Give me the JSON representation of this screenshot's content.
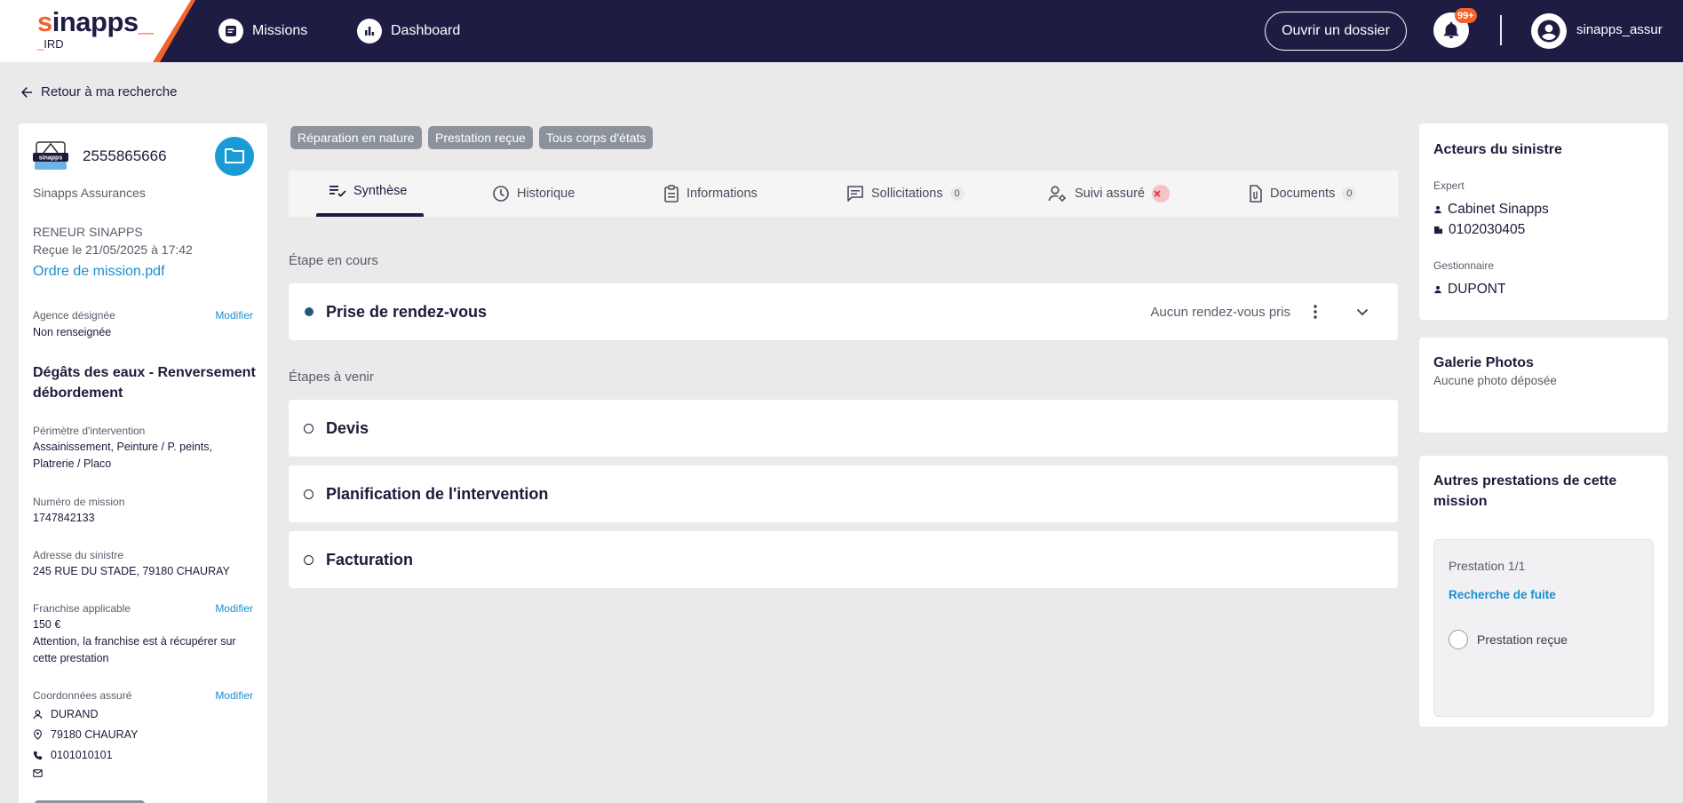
{
  "header": {
    "logo_main": "inapps",
    "logo_s": "s",
    "logo_sub": "IRD",
    "nav": [
      {
        "label": "Missions"
      },
      {
        "label": "Dashboard"
      }
    ],
    "open_button": "Ouvrir un dossier",
    "notif_badge": "99+",
    "username": "sinapps_assur"
  },
  "back_link": "Retour à ma recherche",
  "dossier": {
    "number": "2555865666",
    "insurer": "Sinapps Assurances",
    "logo_text": "sinapps",
    "renewer": "RENEUR SINAPPS",
    "received": "Reçue le 21/05/2025 à 17:42",
    "order_link": "Ordre de mission.pdf",
    "agency_label": "Agence désignée",
    "agency_value": "Non renseignée",
    "modify": "Modifier",
    "sinistre_title_1": "Dégâts des eaux - Renversement",
    "sinistre_title_2": "débordement",
    "perimeter_label": "Périmètre d'intervention",
    "perimeter_value_1": "Assainissement, Peinture / P. peints,",
    "perimeter_value_2": "Platrerie / Placo",
    "mission_label": "Numéro de mission",
    "mission_value": "1747842133",
    "address_label": "Adresse du sinistre",
    "address_value": "245 RUE DU STADE, 79180 CHAURAY",
    "franchise_label": "Franchise applicable",
    "franchise_value": "150 €",
    "franchise_note_1": "Attention, la franchise est à récupérer sur",
    "franchise_note_2": "cette prestation",
    "contact_label": "Coordonnées assuré",
    "contact_name": "DURAND",
    "contact_city": "79180 CHAURAY",
    "contact_phone": "0101010101"
  },
  "chips": [
    "Réparation en nature",
    "Prestation reçue",
    "Tous corps d'états"
  ],
  "tabs": [
    {
      "label": "Synthèse"
    },
    {
      "label": "Historique"
    },
    {
      "label": "Informations"
    },
    {
      "label": "Sollicitations",
      "count": "0"
    },
    {
      "label": "Suivi assuré"
    },
    {
      "label": "Documents",
      "count": "0"
    }
  ],
  "current_step_label": "Étape en cours",
  "current_step": {
    "title": "Prise de rendez-vous",
    "status": "Aucun rendez-vous pris"
  },
  "upcoming_label": "Étapes à venir",
  "upcoming_steps": [
    {
      "title": "Devis"
    },
    {
      "title": "Planification de l'intervention"
    },
    {
      "title": "Facturation"
    }
  ],
  "actors": {
    "title": "Acteurs du sinistre",
    "expert_label": "Expert",
    "expert_name": "Cabinet Sinapps",
    "expert_phone": "0102030405",
    "manager_label": "Gestionnaire",
    "manager_name": "DUPONT"
  },
  "gallery": {
    "title": "Galerie Photos",
    "empty": "Aucune photo déposée"
  },
  "other": {
    "title_1": "Autres prestations de cette",
    "title_2": "mission",
    "prestation_count": "Prestation 1/1",
    "prestation_link": "Recherche de fuite",
    "prestation_status": "Prestation reçue"
  },
  "colors": {
    "navy": "#1f1c44",
    "orange": "#f2642b",
    "blue": "#1a9ad6",
    "chip": "#8d939c"
  }
}
